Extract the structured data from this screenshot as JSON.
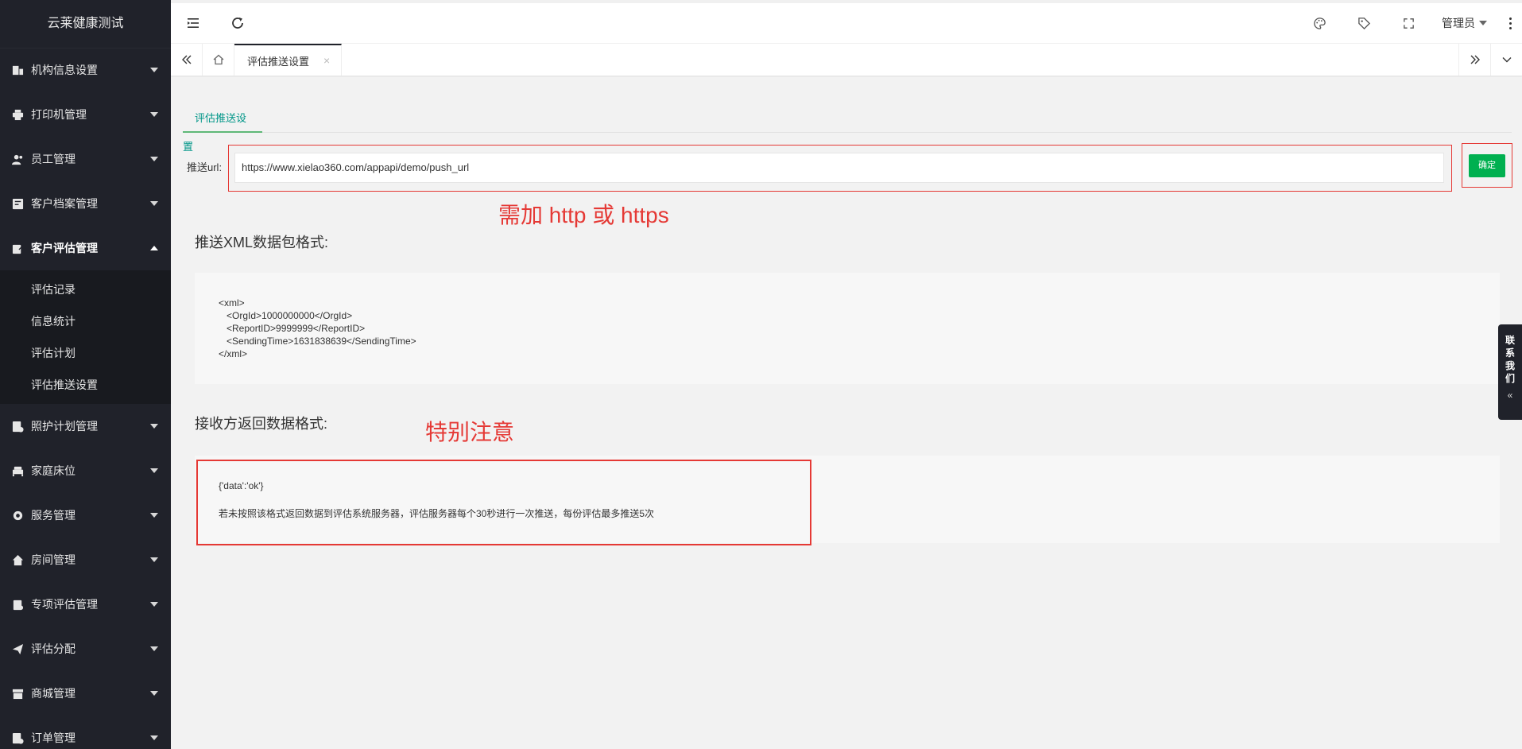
{
  "app": {
    "title": "云莱健康测试"
  },
  "sidebar": {
    "items": [
      {
        "label": "机构信息设置",
        "icon": "building-icon"
      },
      {
        "label": "打印机管理",
        "icon": "printer-icon"
      },
      {
        "label": "员工管理",
        "icon": "users-icon"
      },
      {
        "label": "客户档案管理",
        "icon": "profile-icon"
      },
      {
        "label": "客户评估管理",
        "icon": "edit-icon",
        "open": true,
        "children": [
          "评估记录",
          "信息统计",
          "评估计划",
          "评估推送设置"
        ]
      },
      {
        "label": "照护计划管理",
        "icon": "care-icon"
      },
      {
        "label": "家庭床位",
        "icon": "bed-icon"
      },
      {
        "label": "服务管理",
        "icon": "gear-icon"
      },
      {
        "label": "房间管理",
        "icon": "house-icon"
      },
      {
        "label": "专项评估管理",
        "icon": "clipboard-icon"
      },
      {
        "label": "评估分配",
        "icon": "send-icon"
      },
      {
        "label": "商城管理",
        "icon": "store-icon"
      },
      {
        "label": "订单管理",
        "icon": "order-icon"
      }
    ]
  },
  "header": {
    "admin_label": "管理员"
  },
  "tabs": {
    "current": "评估推送设置",
    "close": "×"
  },
  "page": {
    "sub_tab": "评估推送设置",
    "url_label": "推送url:",
    "url_value": "https://www.xielao360.com/appapi/demo/push_url",
    "confirm": "确定",
    "note_http": "需加 http 或 https",
    "xml_title": "推送XML数据包格式:",
    "xml_lines": [
      "<xml>",
      "   <OrgId>1000000000</OrgId>",
      "   <ReportID>9999999</ReportID>",
      "   <SendingTime>1631838639</SendingTime>",
      "</xml>"
    ],
    "resp_title": "接收方返回数据格式:",
    "note_special": "特别注意",
    "resp_json": "{'data':'ok'}",
    "resp_desc": "若未按照该格式返回数据到评估系统服务器，评估服务器每个30秒进行一次推送，每份评估最多推送5次"
  },
  "contact": {
    "chars": [
      "联",
      "系",
      "我",
      "们"
    ],
    "arrow": "«"
  },
  "colors": {
    "sidebar_bg": "#20222a",
    "accent": "#009688",
    "confirm": "#00b050",
    "annotation": "#e53935"
  }
}
